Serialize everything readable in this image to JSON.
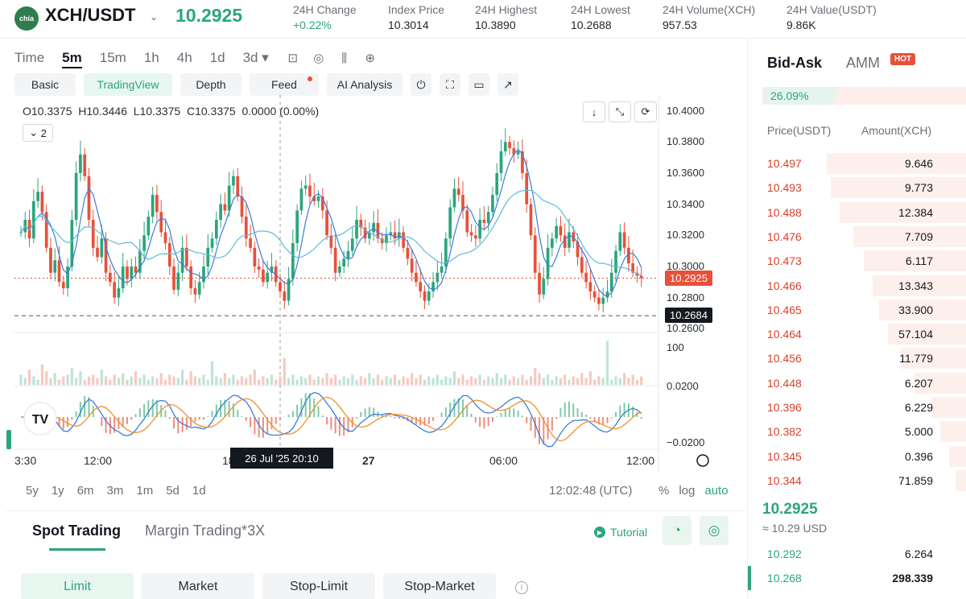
{
  "header": {
    "logo_text": "chia",
    "pair": "XCH/USDT",
    "last_price": "10.2925",
    "stats": [
      {
        "label": "24H Change",
        "value": "+0.22%",
        "up": true
      },
      {
        "label": "Index Price",
        "value": "10.3014",
        "up": false
      },
      {
        "label": "24H Highest",
        "value": "10.3890",
        "up": false
      },
      {
        "label": "24H Lowest",
        "value": "10.2688",
        "up": false
      },
      {
        "label": "24H Volume(XCH)",
        "value": "957.53",
        "up": false
      },
      {
        "label": "24H Value(USDT)",
        "value": "9.86K",
        "up": false
      }
    ]
  },
  "chart_toolbar": {
    "timeframes": [
      "Time",
      "5m",
      "15m",
      "1h",
      "4h",
      "1d",
      "3d ▾"
    ],
    "active_timeframe": "5m",
    "modes": [
      "Basic",
      "TradingView",
      "Depth",
      "Feed",
      "AI Analysis"
    ],
    "active_mode": "TradingView"
  },
  "chart_data": {
    "type": "candlestick",
    "ohlc_legend": {
      "o": "O10.3375",
      "h": "H10.3446",
      "l": "L10.3375",
      "c": "C10.3375",
      "chg": "0.0000 (0.00%)"
    },
    "indicator_count": "2",
    "y_ticks": [
      "10.4000",
      "10.3800",
      "10.3600",
      "10.3400",
      "10.3200",
      "10.3000",
      "10.2800",
      "10.2600"
    ],
    "current_price_tag": "10.2925",
    "low_line_tag": "10.2684",
    "volume_tick": "100",
    "macd_ticks": [
      "0.0200",
      "−0.0200"
    ],
    "x_ticks": [
      "3:30",
      "12:00",
      "18",
      "27",
      "06:00",
      "12:00"
    ],
    "crosshair_label": "26 Jul '25   20:10",
    "ylim": [
      10.255,
      10.405
    ],
    "close_series": [
      10.322,
      10.33,
      10.318,
      10.342,
      10.348,
      10.335,
      10.312,
      10.296,
      10.304,
      10.29,
      10.286,
      10.3,
      10.33,
      10.36,
      10.372,
      10.358,
      10.33,
      10.312,
      10.306,
      10.318,
      10.296,
      10.29,
      10.28,
      10.286,
      10.3,
      10.292,
      10.3,
      10.296,
      10.31,
      10.32,
      10.332,
      10.346,
      10.335,
      10.322,
      10.315,
      10.3,
      10.285,
      10.296,
      10.312,
      10.3,
      10.286,
      10.282,
      10.29,
      10.3,
      10.312,
      10.318,
      10.33,
      10.34,
      10.336,
      10.352,
      10.358,
      10.345,
      10.332,
      10.318,
      10.312,
      10.3,
      10.298,
      10.29,
      10.296,
      10.3,
      10.29,
      10.284,
      10.278,
      10.292,
      10.315,
      10.336,
      10.35,
      10.352,
      10.345,
      10.342,
      10.345,
      10.336,
      10.32,
      10.312,
      10.296,
      10.3,
      10.305,
      10.31,
      10.318,
      10.33,
      10.325,
      10.318,
      10.322,
      10.328,
      10.318,
      10.315,
      10.32,
      10.322,
      10.318,
      10.322,
      10.312,
      10.305,
      10.296,
      10.29,
      10.284,
      10.278,
      10.284,
      10.29,
      10.296,
      10.3,
      10.318,
      10.338,
      10.35,
      10.346,
      10.336,
      10.322,
      10.32,
      10.318,
      10.33,
      10.328,
      10.335,
      10.346,
      10.36,
      10.374,
      10.38,
      10.376,
      10.372,
      10.374,
      10.36,
      10.34,
      10.32,
      10.296,
      10.282,
      10.292,
      10.312,
      10.318,
      10.326,
      10.32,
      10.312,
      10.322,
      10.316,
      10.306,
      10.296,
      10.29,
      10.284,
      10.28,
      10.276,
      10.28,
      10.284,
      10.296,
      10.31,
      10.322,
      10.312,
      10.302,
      10.296,
      10.294,
      10.2925
    ],
    "volume_series": [
      6,
      4,
      9,
      5,
      3,
      12,
      8,
      4,
      7,
      3,
      5,
      6,
      10,
      4,
      8,
      3,
      5,
      6,
      4,
      9,
      5,
      3,
      6,
      4,
      7,
      3,
      5,
      8,
      4,
      6,
      3,
      5,
      4,
      7,
      3,
      6,
      5,
      4,
      9,
      3,
      8,
      5,
      4,
      6,
      3,
      14,
      5,
      4,
      7,
      4,
      6,
      3,
      5,
      4,
      6,
      9,
      3,
      5,
      4,
      6,
      3,
      5,
      16,
      4,
      6,
      3,
      5,
      4,
      6,
      3,
      5,
      4,
      7,
      4,
      6,
      3,
      5,
      4,
      6,
      3,
      5,
      4,
      7,
      4,
      6,
      3,
      5,
      4,
      6,
      3,
      5,
      4,
      7,
      4,
      6,
      3,
      5,
      4,
      6,
      3,
      5,
      4,
      8,
      4,
      6,
      3,
      5,
      4,
      6,
      3,
      5,
      4,
      7,
      4,
      6,
      3,
      5,
      4,
      6,
      3,
      5,
      10,
      7,
      4,
      6,
      3,
      5,
      4,
      6,
      3,
      5,
      4,
      7,
      4,
      8,
      3,
      5,
      4,
      26,
      3,
      5,
      4,
      7,
      4,
      6,
      3,
      5
    ]
  },
  "range_buttons": [
    "5y",
    "1y",
    "6m",
    "3m",
    "1m",
    "5d",
    "1d"
  ],
  "clock": "12:02:48 (UTC)",
  "scale_options": [
    "%",
    "log",
    "auto"
  ],
  "trading": {
    "tabs": [
      "Spot Trading",
      "Margin Trading*3X"
    ],
    "active_tab": "Spot Trading",
    "tutorial": "Tutorial",
    "order_types": [
      "Limit",
      "Market",
      "Stop-Limit",
      "Stop-Market"
    ]
  },
  "orderbook": {
    "tabs": [
      "Bid-Ask",
      "AMM"
    ],
    "hot_badge": "HOT",
    "ratio_text": "26.09%",
    "ratio_value": 26.09,
    "col_price": "Price(USDT)",
    "col_amount": "Amount(XCH)",
    "asks": [
      {
        "price": "10.497",
        "amount": "9.646",
        "depth": 0.64
      },
      {
        "price": "10.493",
        "amount": "9.773",
        "depth": 0.62
      },
      {
        "price": "10.488",
        "amount": "12.384",
        "depth": 0.58
      },
      {
        "price": "10.476",
        "amount": "7.709",
        "depth": 0.52
      },
      {
        "price": "10.473",
        "amount": "6.117",
        "depth": 0.47
      },
      {
        "price": "10.466",
        "amount": "13.343",
        "depth": 0.43
      },
      {
        "price": "10.465",
        "amount": "33.900",
        "depth": 0.4
      },
      {
        "price": "10.464",
        "amount": "57.104",
        "depth": 0.36
      },
      {
        "price": "10.456",
        "amount": "11.779",
        "depth": 0.3
      },
      {
        "price": "10.448",
        "amount": "6.207",
        "depth": 0.24
      },
      {
        "price": "10.396",
        "amount": "6.229",
        "depth": 0.16
      },
      {
        "price": "10.382",
        "amount": "5.000",
        "depth": 0.12
      },
      {
        "price": "10.345",
        "amount": "0.396",
        "depth": 0.08
      },
      {
        "price": "10.344",
        "amount": "71.859",
        "depth": 0.05
      }
    ],
    "mid_price": "10.2925",
    "mid_usd": "≈ 10.29  USD",
    "bids": [
      {
        "price": "10.292",
        "amount": "6.264",
        "depth": 0.0
      },
      {
        "price": "10.268",
        "amount": "298.339",
        "depth": 0.0
      }
    ]
  },
  "colors": {
    "up": "#2ba57c",
    "down": "#e8503a",
    "ma_fast": "#3b7dd8",
    "ma_slow": "#5bbcd6",
    "macd_signal": "#f0902b"
  }
}
